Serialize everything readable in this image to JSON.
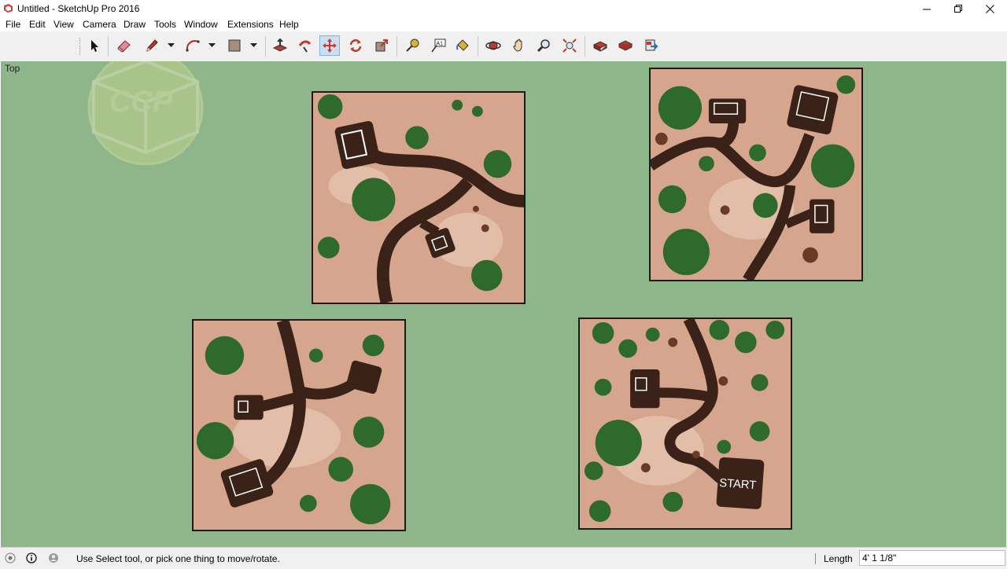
{
  "window": {
    "title": "Untitled - SketchUp Pro 2016",
    "controls": [
      "minimize",
      "restore",
      "close"
    ]
  },
  "menu": [
    "File",
    "Edit",
    "View",
    "Camera",
    "Draw",
    "Tools",
    "Window",
    "Extensions",
    "Help"
  ],
  "toolbar": {
    "tools": [
      {
        "name": "select-tool",
        "icon": "arrow-cursor-icon"
      },
      {
        "name": "eraser-tool",
        "icon": "eraser-icon"
      },
      {
        "name": "line-tool",
        "icon": "pencil-icon"
      },
      {
        "name": "arc-tool",
        "icon": "arc-icon"
      },
      {
        "name": "rectangle-tool",
        "icon": "rectangle-icon"
      },
      {
        "name": "push-pull-tool",
        "icon": "push-pull-icon"
      },
      {
        "name": "follow-me-tool",
        "icon": "follow-me-icon"
      },
      {
        "name": "move-tool",
        "icon": "move-arrows-icon",
        "active": true
      },
      {
        "name": "rotate-tool",
        "icon": "rotate-icon"
      },
      {
        "name": "scale-tool",
        "icon": "scale-icon"
      },
      {
        "name": "tape-measure-tool",
        "icon": "tape-measure-icon"
      },
      {
        "name": "text-tool",
        "icon": "text-a1-icon",
        "text": "A1"
      },
      {
        "name": "paint-bucket-tool",
        "icon": "paint-bucket-icon"
      },
      {
        "name": "orbit-tool",
        "icon": "orbit-icon"
      },
      {
        "name": "pan-tool",
        "icon": "hand-icon"
      },
      {
        "name": "zoom-tool",
        "icon": "magnifier-icon"
      },
      {
        "name": "zoom-extents-tool",
        "icon": "zoom-extents-icon"
      },
      {
        "name": "3d-warehouse",
        "icon": "warehouse-icon"
      },
      {
        "name": "extension-warehouse",
        "icon": "extension-warehouse-icon"
      },
      {
        "name": "send-to-layout",
        "icon": "layout-icon"
      }
    ],
    "active_color": "#c9dff4"
  },
  "viewport": {
    "view_name": "Top",
    "background_color": "#8fb58a",
    "watermark_text": "CCP",
    "tiles": [
      {
        "name": "tile-top-left",
        "label": ""
      },
      {
        "name": "tile-top-right",
        "label": ""
      },
      {
        "name": "tile-bottom-left",
        "label": ""
      },
      {
        "name": "tile-bottom-right",
        "label": "START"
      }
    ]
  },
  "statusbar": {
    "message": "Use Select tool, or pick one thing to move/rotate.",
    "measurement_label": "Length",
    "measurement_value": "4' 1 1/8\""
  },
  "colors": {
    "terrain": "#d6a58e",
    "road": "#3a2218",
    "bush": "#2e6a2c",
    "tile_border": "#1a1a1a"
  }
}
